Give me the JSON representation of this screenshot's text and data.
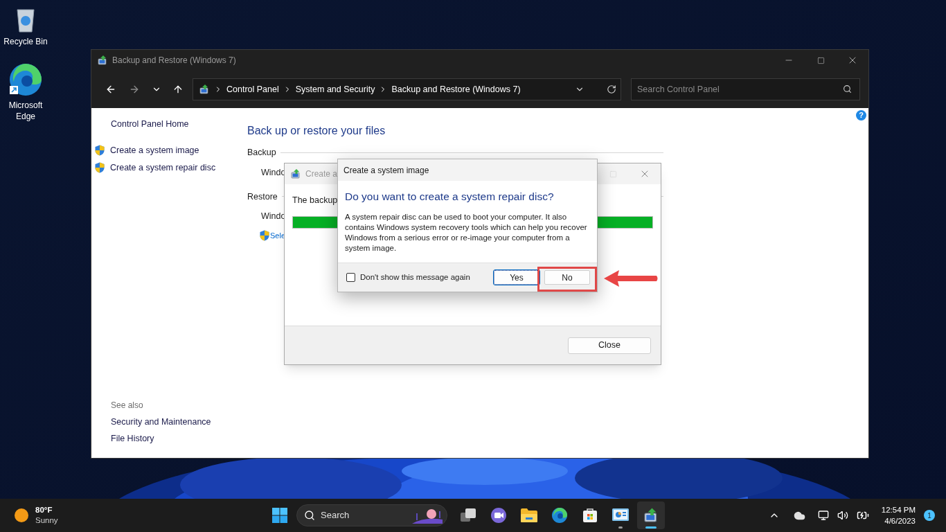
{
  "desktop_icons": [
    {
      "label": "Recycle Bin",
      "kind": "recycle"
    },
    {
      "label": "Microsoft Edge",
      "kind": "edge"
    }
  ],
  "window": {
    "title": "Backup and Restore (Windows 7)",
    "breadcrumb": [
      "Control Panel",
      "System and Security",
      "Backup and Restore (Windows 7)"
    ],
    "search": {
      "placeholder": "Search Control Panel"
    },
    "help": "?",
    "sidebar": {
      "home": "Control Panel Home",
      "tasks": [
        "Create a system image",
        "Create a system repair disc"
      ],
      "see_also_heading": "See also",
      "see_also": [
        "Security and Maintenance",
        "File History"
      ]
    },
    "main": {
      "heading": "Back up or restore your files",
      "sections": [
        {
          "title": "Backup",
          "lines": [
            {
              "text": "Windo",
              "kind": "text"
            }
          ]
        },
        {
          "title": "Restore",
          "lines": [
            {
              "text": "Windo",
              "kind": "text"
            },
            {
              "text": "Sele",
              "kind": "link"
            }
          ]
        }
      ]
    }
  },
  "progress_dialog": {
    "title": "Create a",
    "message": "The backup",
    "level": 1,
    "close_button": "Close"
  },
  "message_box": {
    "title": "Create a system image",
    "heading": "Do you want to create a system repair disc?",
    "body": "A system repair disc can be used to boot your computer. It also contains Windows system recovery tools which can help you recover Windows from a serious error or re-image your computer from a system image.",
    "checkbox": {
      "label": "Don't show this message again",
      "checked": false
    },
    "buttons": [
      {
        "label": "Yes",
        "focused": true,
        "highlighted": false
      },
      {
        "label": "No",
        "focused": false,
        "highlighted": true
      }
    ]
  },
  "taskbar": {
    "weather": {
      "temperature": "80°F",
      "condition": "Sunny"
    },
    "search": "Search",
    "apps": [
      {
        "kind": "task_view",
        "running": false,
        "selected": false
      },
      {
        "kind": "chat",
        "running": false,
        "selected": false
      },
      {
        "kind": "explorer",
        "running": false,
        "selected": false
      },
      {
        "kind": "edge",
        "running": false,
        "selected": false
      },
      {
        "kind": "store",
        "running": false,
        "selected": false
      },
      {
        "kind": "control_panel",
        "running": true,
        "selected": false
      },
      {
        "kind": "backup",
        "running": true,
        "selected": true
      }
    ],
    "clock": {
      "time": "12:54 PM",
      "date": "4/6/2023"
    },
    "notifications": "1"
  }
}
